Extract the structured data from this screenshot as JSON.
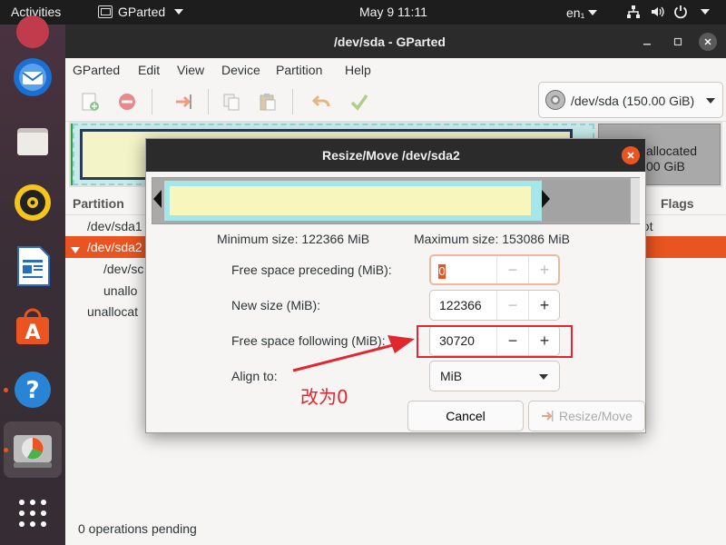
{
  "topbar": {
    "activities": "Activities",
    "app_name": "GParted",
    "clock": "May 9  11:11",
    "language": "en₁"
  },
  "window": {
    "title": "/dev/sda - GParted",
    "menus": [
      "GParted",
      "Edit",
      "View",
      "Device",
      "Partition",
      "Help"
    ],
    "device_selector": "/dev/sda (150.00 GiB)",
    "disk_map": {
      "unallocated_label": "allocated",
      "unallocated_size": "00 GiB"
    },
    "list_header": {
      "partition": "Partition",
      "flags": "Flags"
    },
    "rows": [
      {
        "partition": "/dev/sda1",
        "flags": "oot"
      },
      {
        "partition": "/dev/sda2",
        "flags": ""
      },
      {
        "partition": "/dev/sc",
        "flags": ""
      },
      {
        "partition": "unallo",
        "flags": ""
      },
      {
        "partition": "unallocat",
        "flags": ""
      }
    ],
    "status": "0 operations pending"
  },
  "dialog": {
    "title": "Resize/Move /dev/sda2",
    "minimum_size": "Minimum size: 122366 MiB",
    "maximum_size": "Maximum size: 153086 MiB",
    "fields": {
      "preceding_label": "Free space preceding (MiB):",
      "preceding_value": "0",
      "new_size_label": "New size (MiB):",
      "new_size_value": "122366",
      "following_label": "Free space following (MiB):",
      "following_value": "30720",
      "align_label": "Align to:",
      "align_value": "MiB"
    },
    "buttons": {
      "cancel": "Cancel",
      "resize_move": "Resize/Move"
    },
    "stepper": {
      "minus": "−",
      "plus": "+"
    }
  },
  "annotation": {
    "text": "改为0",
    "color": "#e0262e"
  },
  "colors": {
    "accent": "#e95420",
    "titlebar": "#2b2b2b",
    "partition_fill": "#a5e7e8",
    "partition_inner": "#f7f7bd",
    "unallocated": "#a9a9a9"
  }
}
